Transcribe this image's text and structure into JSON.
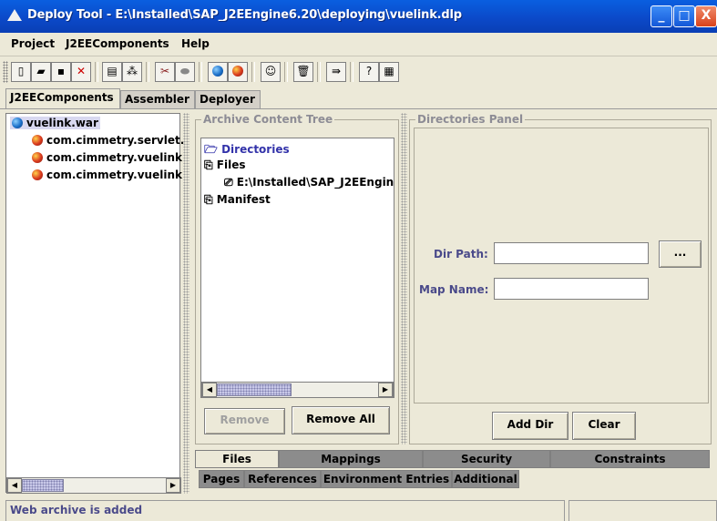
{
  "window": {
    "title": "Deploy Tool - E:\\Installed\\SAP_J2EEngine6.20\\deploying\\vuelink.dlp",
    "minimize_label": "_",
    "maximize_label": "□",
    "close_label": "X"
  },
  "menu": [
    "Project",
    "J2EEComponents",
    "Help"
  ],
  "main_tabs": [
    "J2EEComponents",
    "Assembler",
    "Deployer"
  ],
  "left_tree": {
    "root": "vuelink.war",
    "children": [
      "com.cimmetry.servlet.",
      "com.cimmetry.vuelink",
      "com.cimmetry.vuelink"
    ]
  },
  "archive": {
    "legend": "Archive Content Tree",
    "nodes": {
      "directories": "Directories",
      "files": "Files",
      "file_path": "E:\\Installed\\SAP_J2EEngin",
      "manifest": "Manifest"
    },
    "remove_label": "Remove",
    "remove_all_label": "Remove All"
  },
  "directories_panel": {
    "legend": "Directories Panel",
    "dir_path_label": "Dir Path:",
    "dir_path_value": "",
    "browse_label": "...",
    "map_name_label": "Map Name:",
    "map_name_value": "",
    "add_dir_label": "Add Dir",
    "clear_label": "Clear"
  },
  "bottom_tabs_row1": [
    "Files",
    "Mappings",
    "Security",
    "Constraints"
  ],
  "bottom_tabs_row2": [
    "Pages",
    "References",
    "Environment Entries",
    "Additional"
  ],
  "status": "Web archive is added"
}
